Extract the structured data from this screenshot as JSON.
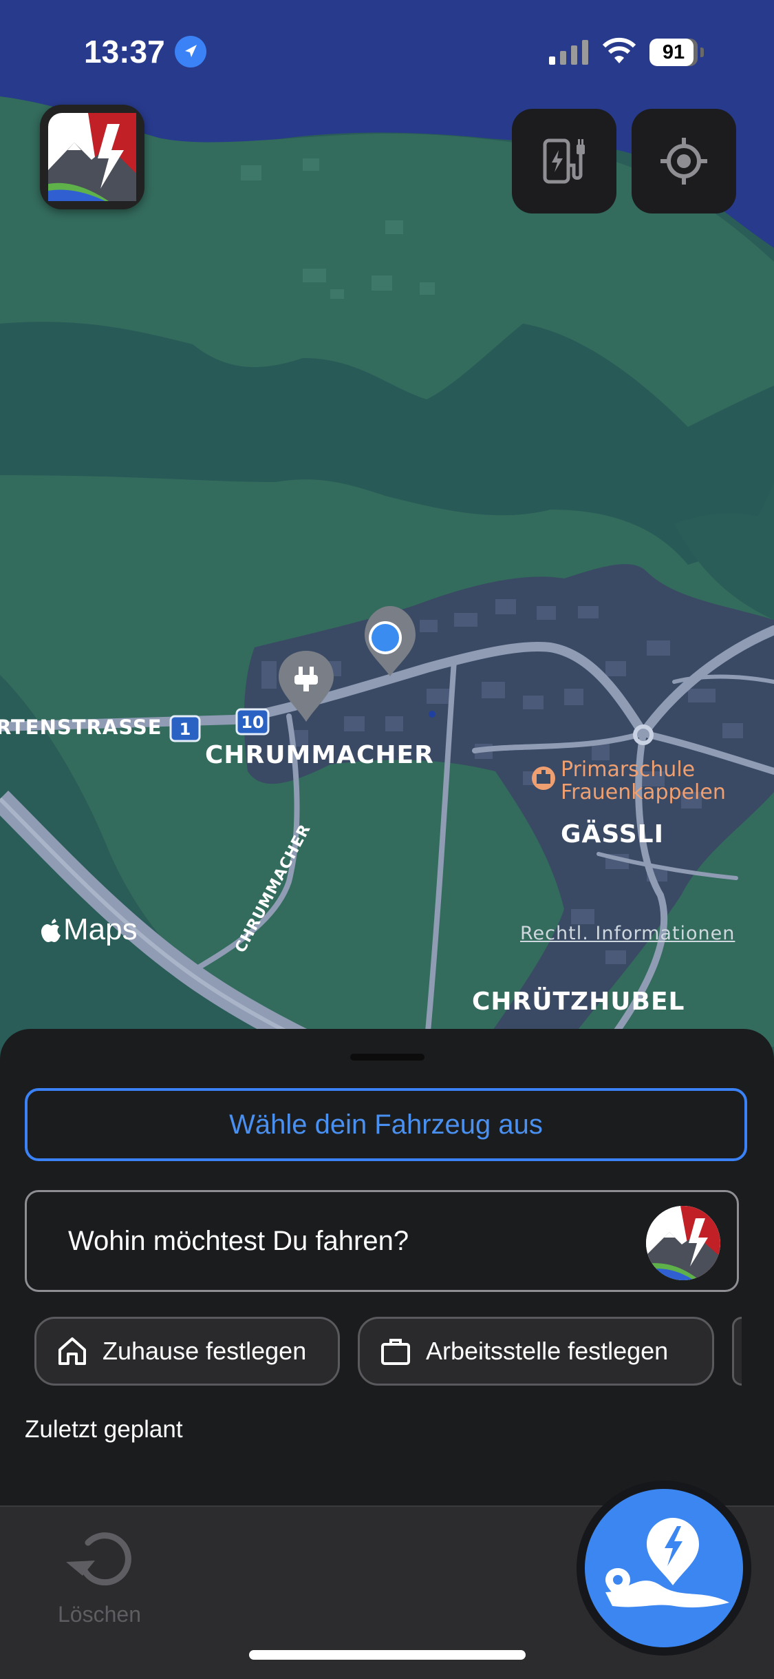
{
  "status_bar": {
    "time": "13:37",
    "battery": "91",
    "battery_fraction": 0.91,
    "icons": [
      "location-arrow-icon",
      "cellular-signal-icon",
      "wifi-icon",
      "battery-icon"
    ]
  },
  "map": {
    "labels": {
      "street_left": "RTENSTRASSE",
      "route_1": "1",
      "route_10": "10",
      "chrummacher": "CHRUMMACHER",
      "chrummacher_road": "CHRUMMACHER",
      "poi_line1": "Primarschule",
      "poi_line2": "Frauenkappelen",
      "gassli": "GÄSSLI",
      "chrutzhubel": "CHRÜTZHUBEL"
    },
    "attribution": "Maps",
    "legal_link": "Rechtl. Informationen",
    "colors": {
      "water": "#283a8c",
      "land": "#326b5c",
      "forest": "#2a5c58",
      "settlement": "#3a4a64",
      "road": "#8f9cb4"
    }
  },
  "top_buttons": {
    "charging_station_icon": "charging-station-icon",
    "locate_icon": "crosshair-locate-icon"
  },
  "sheet": {
    "vehicle_button": "Wähle dein Fahrzeug aus",
    "search_placeholder": "Wohin möchtest Du fahren?",
    "chips": [
      {
        "label": "Zuhause festlegen",
        "icon": "home-icon"
      },
      {
        "label": "Arbeitsstelle festlegen",
        "icon": "briefcase-icon"
      }
    ],
    "recent_title": "Zuletzt geplant"
  },
  "bottom": {
    "clear_label": "Löschen",
    "route_button_icon": "route-planner-icon"
  },
  "colors": {
    "accent": "#3b82f6",
    "sheet_bg": "#1b1c1e",
    "bar_bg": "#2c2c2e"
  }
}
